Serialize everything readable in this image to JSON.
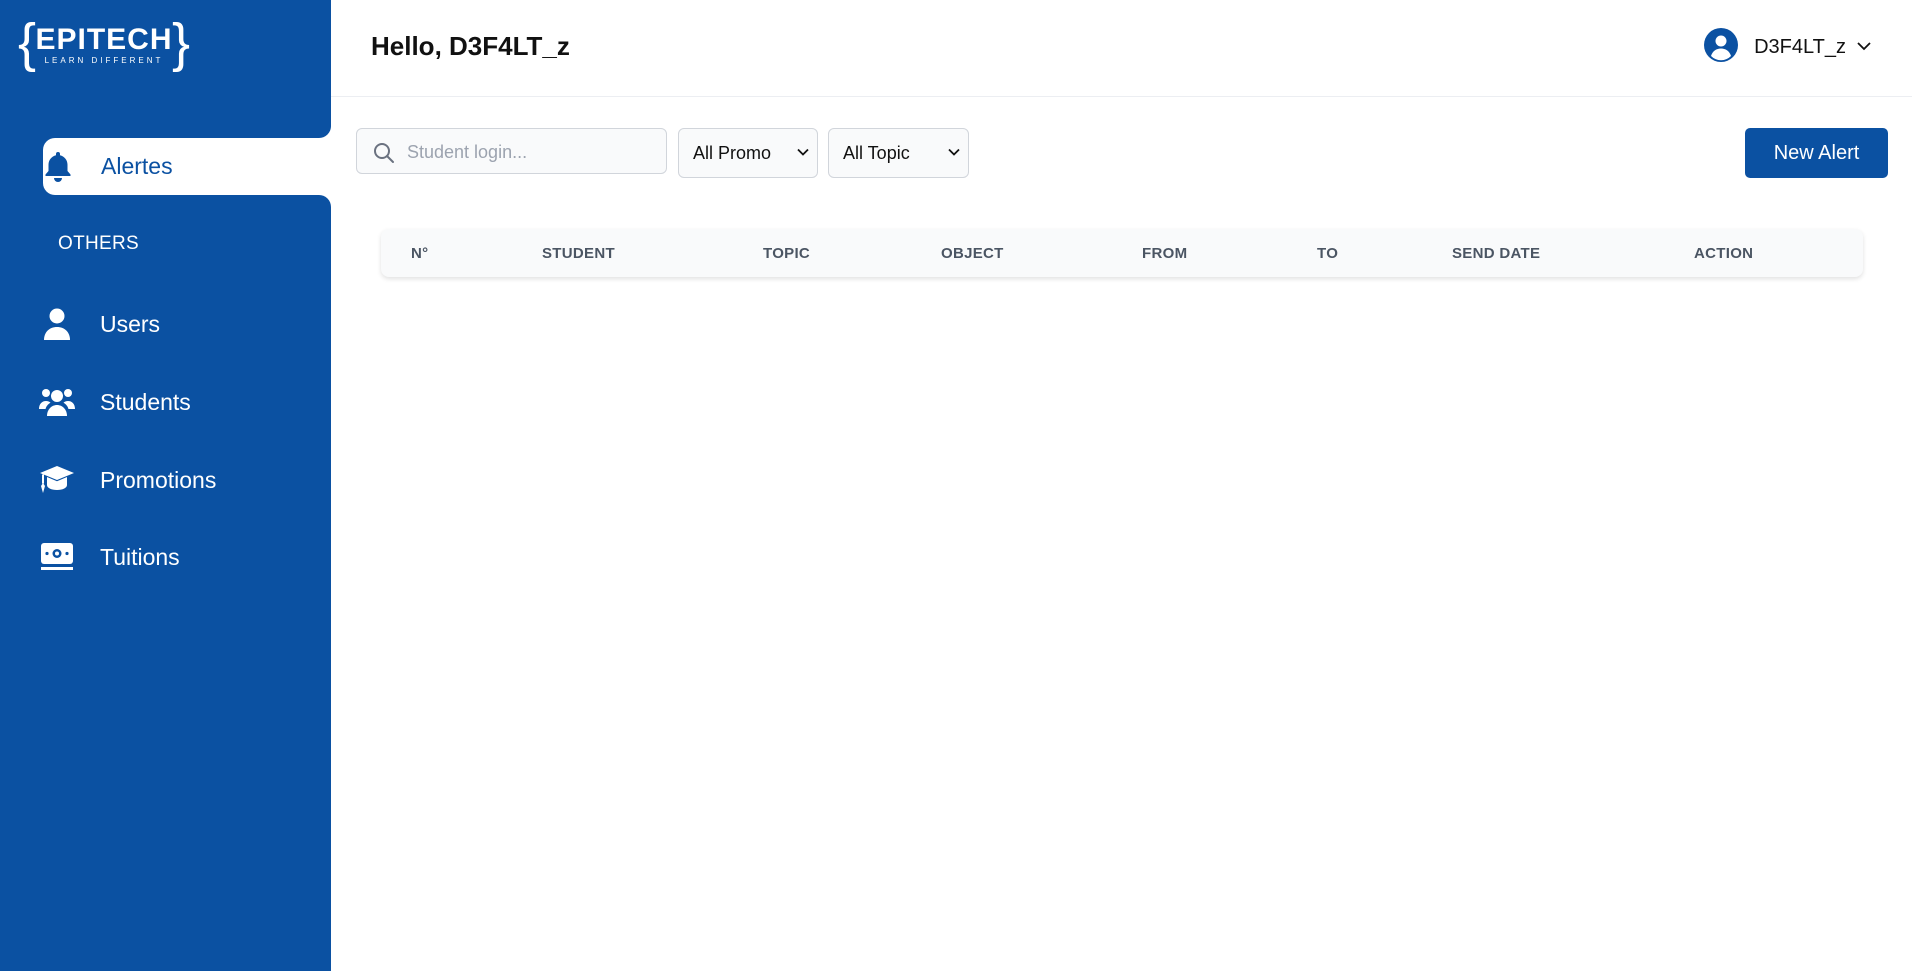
{
  "sidebar": {
    "logo": {
      "brace_left": "{",
      "word": "EPITECH",
      "tagline": "LEARN DIFFERENT",
      "brace_right": "}"
    },
    "main_items": [
      {
        "label": "Alertes",
        "icon": "bell-icon",
        "active": true
      }
    ],
    "section_title": "OTHERS",
    "other_items": [
      {
        "label": "Users",
        "icon": "user-icon"
      },
      {
        "label": "Students",
        "icon": "users-group-icon"
      },
      {
        "label": "Promotions",
        "icon": "graduation-cap-icon"
      },
      {
        "label": "Tuitions",
        "icon": "money-bill-icon"
      }
    ]
  },
  "header": {
    "greeting": "Hello, D3F4LT_z",
    "username": "D3F4LT_z"
  },
  "filters": {
    "search_placeholder": "Student login...",
    "search_value": "",
    "promo_selected": "All Promo",
    "topic_selected": "All Topic"
  },
  "actions": {
    "new_alert_label": "New Alert"
  },
  "table": {
    "columns": [
      "N°",
      "STUDENT",
      "TOPIC",
      "OBJECT",
      "FROM",
      "TO",
      "SEND DATE",
      "ACTION"
    ],
    "rows": []
  },
  "colors": {
    "brand": "#0b51a2",
    "header_text": "#4b5563"
  }
}
